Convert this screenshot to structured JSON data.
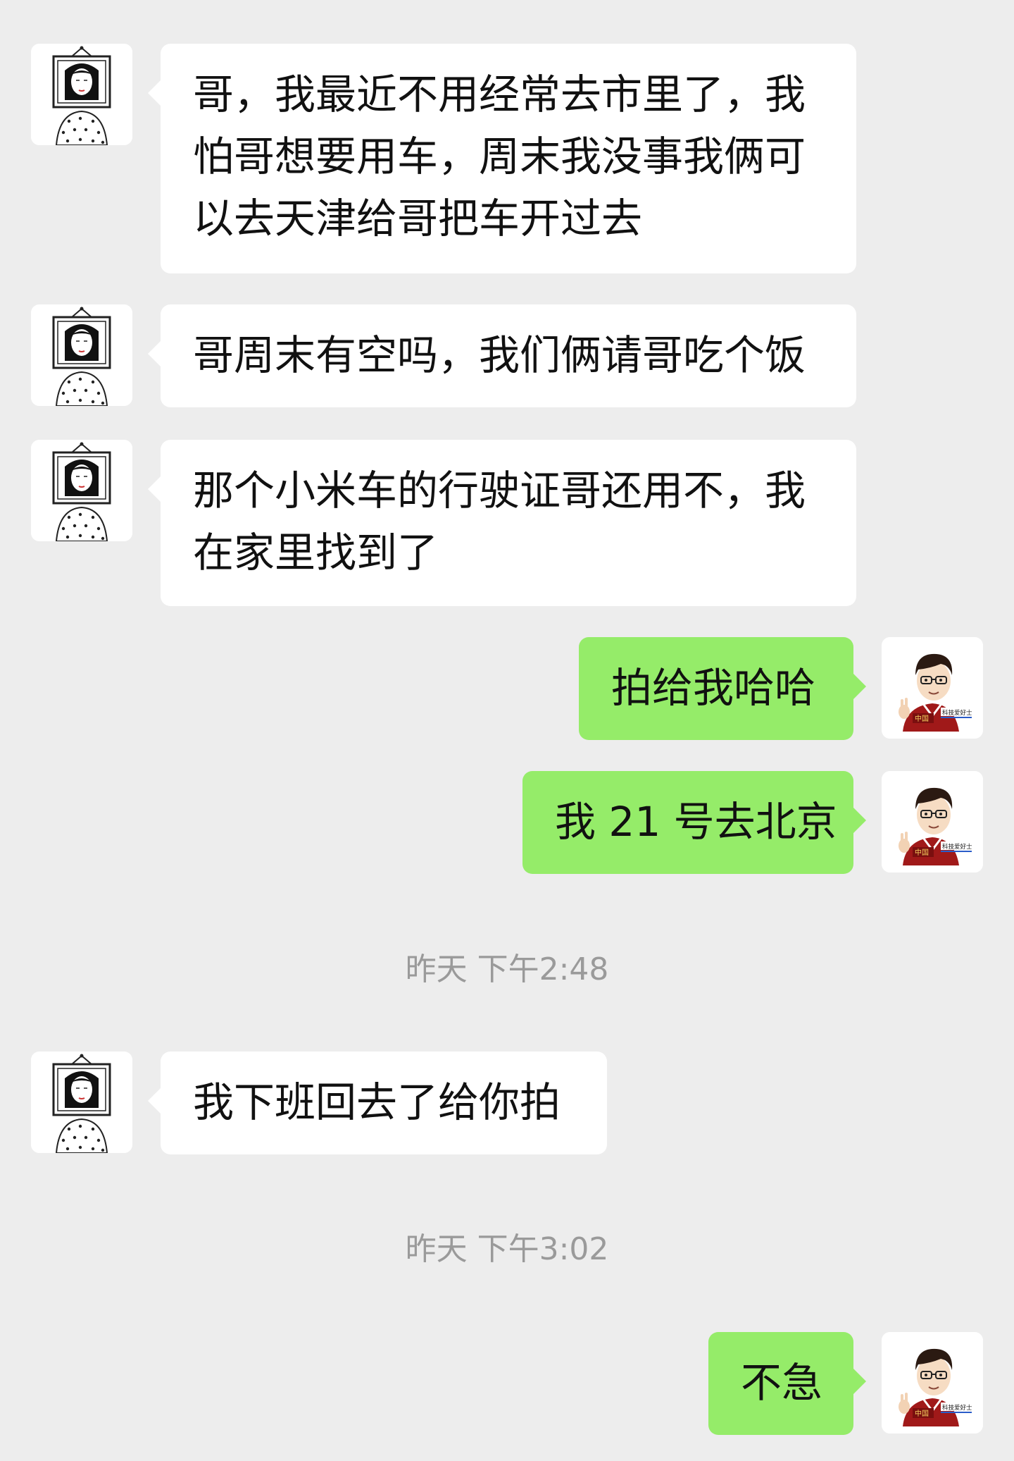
{
  "messages": [
    {
      "lines": [
        "哥，我最近不用经常去市里了，我",
        "怕哥想要用车，周末我没事我俩可",
        "以去天津给哥把车开过去"
      ]
    },
    {
      "lines": [
        "哥周末有空吗，我们俩请哥吃个饭"
      ]
    },
    {
      "lines": [
        "那个小米车的行驶证哥还用不，我",
        "在家里找到了"
      ]
    },
    {
      "lines": [
        "拍给我哈哈"
      ]
    },
    {
      "lines": [
        "我 21 号去北京"
      ]
    },
    {
      "lines": [
        "我下班回去了给你拍"
      ]
    },
    {
      "lines": [
        "不急"
      ]
    }
  ],
  "timestamps": [
    "昨天 下午2:48",
    "昨天 下午3:02"
  ],
  "avatars": {
    "contact": {
      "icon": "girl-portrait-avatar"
    },
    "self": {
      "icon": "cartoon-man-avatar",
      "badge_text": "科技爱好士",
      "shirt_text": "中国"
    }
  },
  "colors": {
    "background": "#ededed",
    "incoming_bubble": "#ffffff",
    "outgoing_bubble": "#95ec69",
    "timestamp_text": "#9a9a9a"
  }
}
